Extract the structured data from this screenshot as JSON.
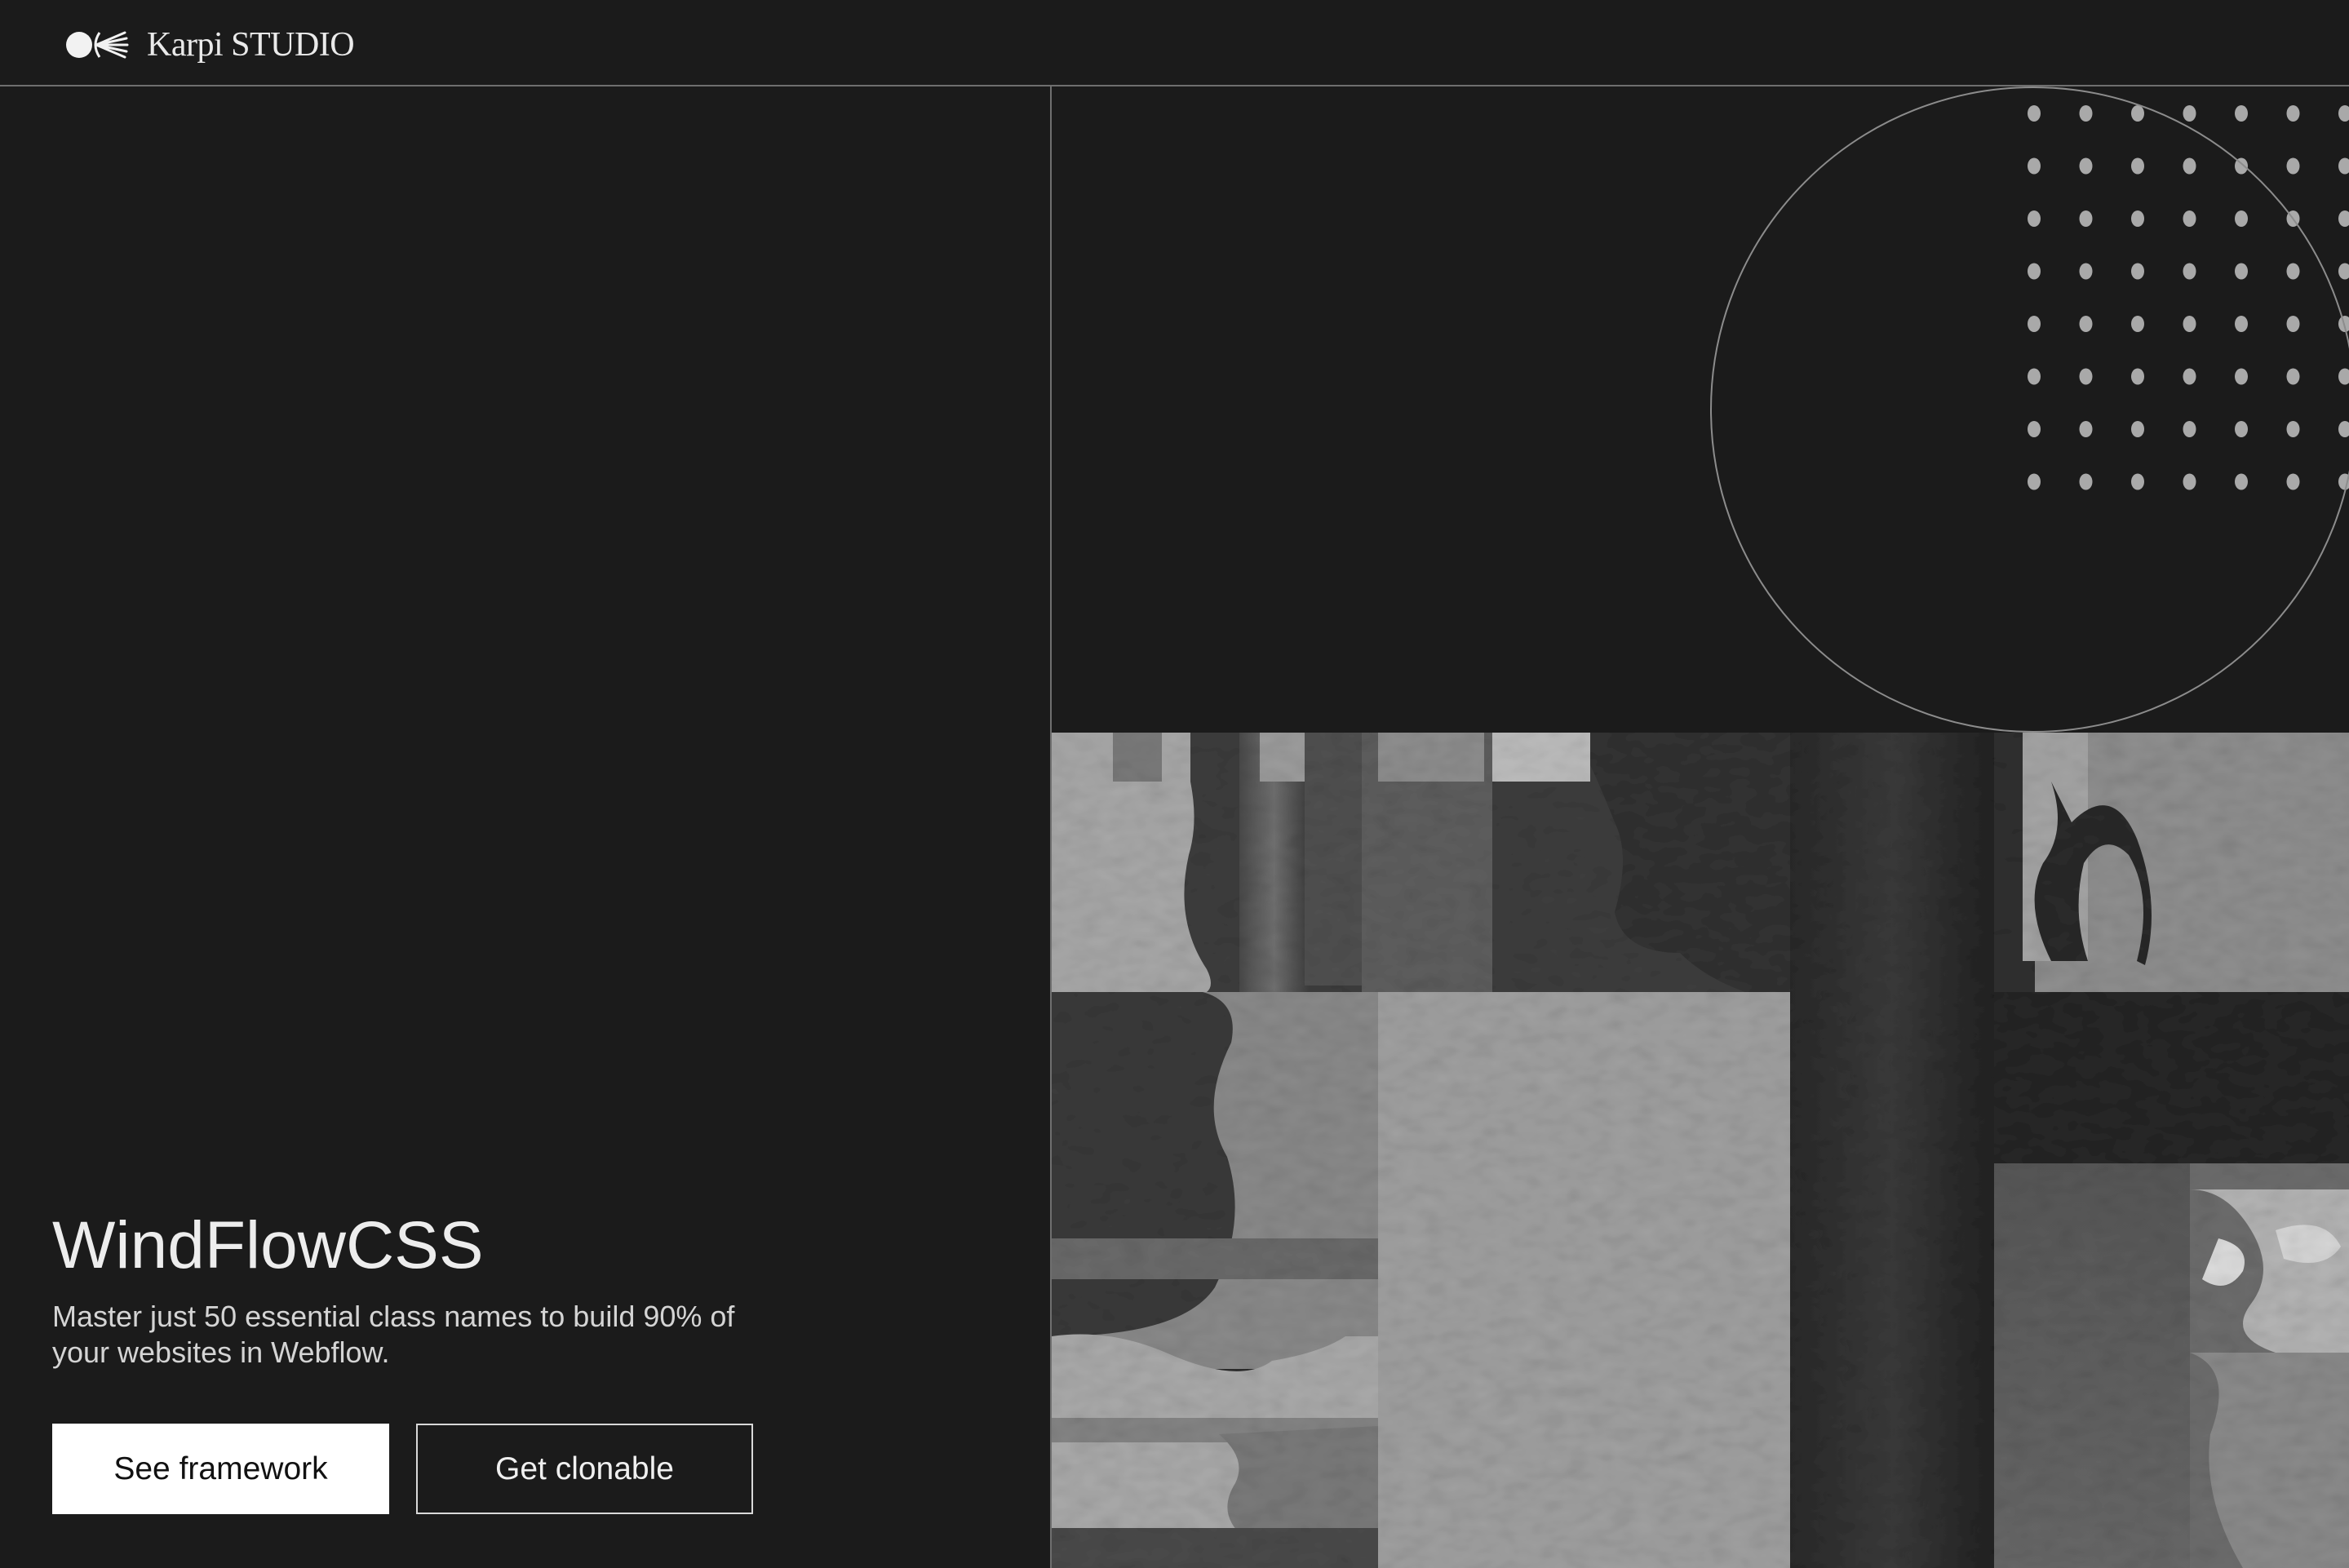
{
  "header": {
    "brand_name": "Karpi STUDIO"
  },
  "hero": {
    "title": "WindFlowCSS",
    "subtitle": "Master just 50 essential class names to build 90% of your websites in Webflow.",
    "primary_button_label": "See framework",
    "secondary_button_label": "Get clonable"
  },
  "colors": {
    "background": "#1b1b1b",
    "text": "#ececec",
    "divider": "#6f6f6f",
    "primary_button_bg": "#ffffff",
    "primary_button_text": "#111111"
  },
  "icons": {
    "logo": "karpi-logo-icon"
  }
}
